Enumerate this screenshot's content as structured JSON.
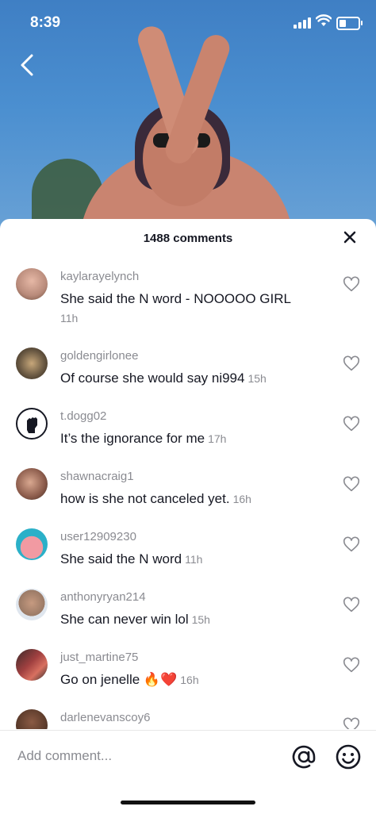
{
  "status_bar": {
    "time": "8:39"
  },
  "comments_header": {
    "count_label": "1488 comments",
    "close_icon": "close-icon"
  },
  "comments": [
    {
      "username": "kaylarayelynch",
      "text": "She said the N word - NOOOOO GIRL",
      "time": "11h",
      "time_on_new_line": true,
      "avatar_color": "#b88a7a"
    },
    {
      "username": "goldengirlonee",
      "text": "Of course she would say ni994",
      "time": "15h",
      "avatar_color": "#6b5a44"
    },
    {
      "username": "t.dogg02",
      "text": "It’s the ignorance for me",
      "time": "17h",
      "avatar_color": "#ffffff",
      "avatar_icon": "raised-fist-icon"
    },
    {
      "username": "shawnacraig1",
      "text": "how is she not canceled yet.",
      "time": "16h",
      "avatar_color": "#8a5a4a"
    },
    {
      "username": "user12909230",
      "text": "She said the N word",
      "time": "11h",
      "avatar_color": "#f19aa2"
    },
    {
      "username": "anthonyryan214",
      "text": "She can never win lol",
      "time": "15h",
      "avatar_color": "#9a7a66"
    },
    {
      "username": "just_martine75",
      "text": "Go on jenelle 🔥❤️",
      "time": "16h",
      "avatar_color": "#a04040"
    },
    {
      "username": "darlenevanscoy6",
      "text": "",
      "time": "",
      "avatar_color": "#5a3a2a"
    }
  ],
  "footer": {
    "placeholder": "Add comment...",
    "mention_icon": "at-sign-icon",
    "emoji_icon": "emoji-icon"
  }
}
